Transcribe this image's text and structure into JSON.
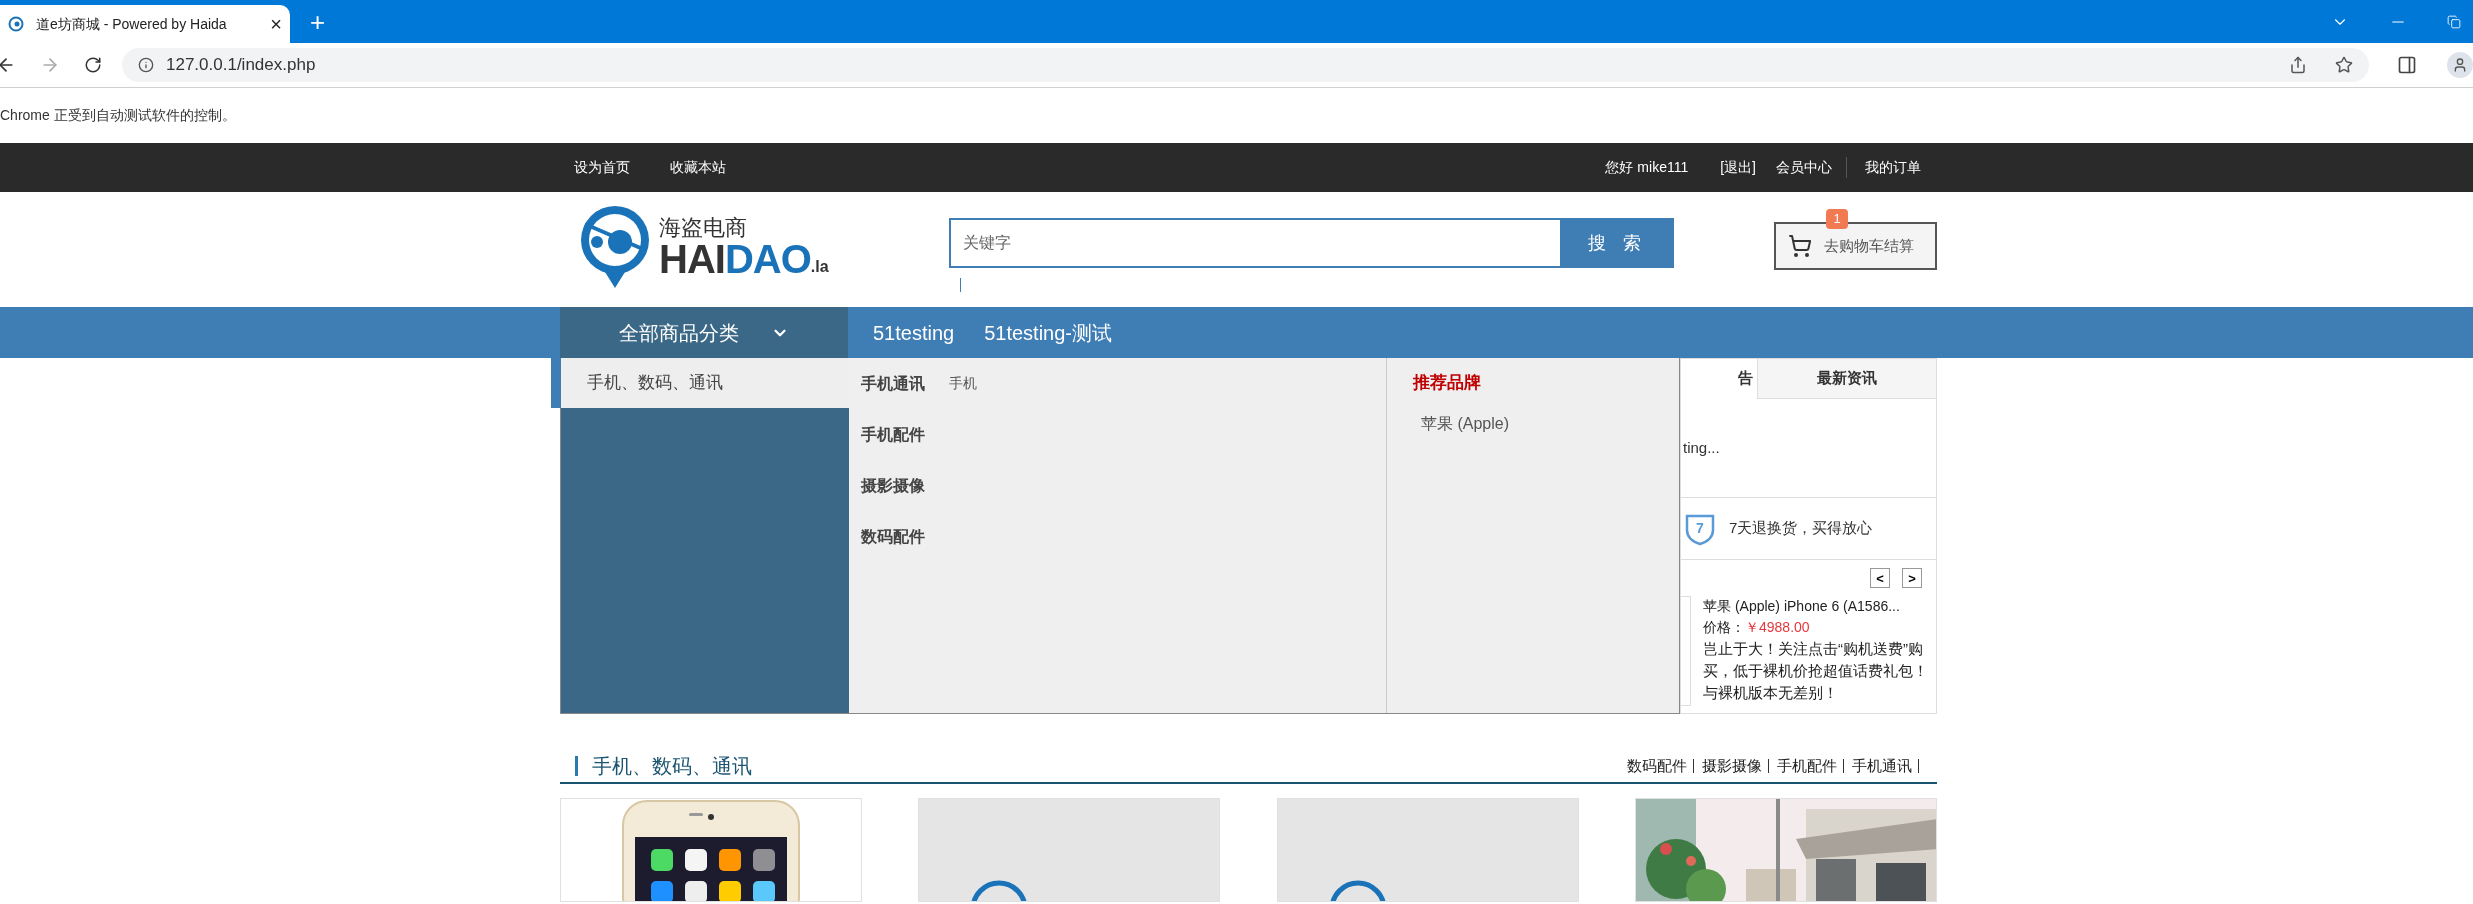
{
  "browser": {
    "tab_title": "道e坊商城 - Powered by Haida",
    "close": "×",
    "new_tab": "+",
    "address": "127.0.0.1/index.php",
    "infobar": "Chrome 正受到自动测试软件的控制。"
  },
  "topbar": {
    "left": [
      "设为首页",
      "收藏本站"
    ],
    "greeting": "您好 mike111",
    "right": [
      "[退出]",
      "会员中心",
      "我的订单"
    ]
  },
  "logo": {
    "tagline": "海盗电商",
    "name": "HAI",
    "name_accent": "DAO",
    "suffix": ".la"
  },
  "search": {
    "placeholder": "关键字",
    "button": "搜 索"
  },
  "cart": {
    "label": "去购物车结算",
    "count": "1"
  },
  "nav": {
    "all_categories": "全部商品分类",
    "items": [
      "51testing",
      "51testing-测试"
    ]
  },
  "category_menu": {
    "categories": [
      {
        "label": "手机、数码、通讯",
        "selected": true
      }
    ],
    "groups": [
      {
        "title": "手机通讯",
        "items": [
          "手机"
        ]
      },
      {
        "title": "手机配件"
      },
      {
        "title": "摄影摄像"
      },
      {
        "title": "数码配件"
      }
    ],
    "brands": {
      "title": "推荐品牌",
      "items": [
        "苹果 (Apple)"
      ]
    }
  },
  "side_panel": {
    "tabs": [
      {
        "label": "告",
        "selected": true
      },
      {
        "label": "最新资讯",
        "selected": false
      }
    ],
    "notice": "ting...",
    "guarantee_number": "7",
    "guarantee": "7天退换货，买得放心",
    "prev": "<",
    "next": ">",
    "product": {
      "title": "苹果 (Apple) iPhone 6 (A1586...",
      "price_label": "价格：",
      "price": "￥4988.00",
      "description": "岂止于大！关注点击“购机送费”购买，低于裸机价抢超值话费礼包！与裸机版本无差别！"
    }
  },
  "floor": {
    "title": "手机、数码、通讯",
    "links": [
      "数码配件",
      "摄影摄像",
      "手机配件",
      "手机通讯"
    ],
    "products": [
      {
        "kind": "phone"
      },
      {
        "kind": "placeholder"
      },
      {
        "kind": "placeholder"
      },
      {
        "kind": "picture"
      }
    ]
  }
}
